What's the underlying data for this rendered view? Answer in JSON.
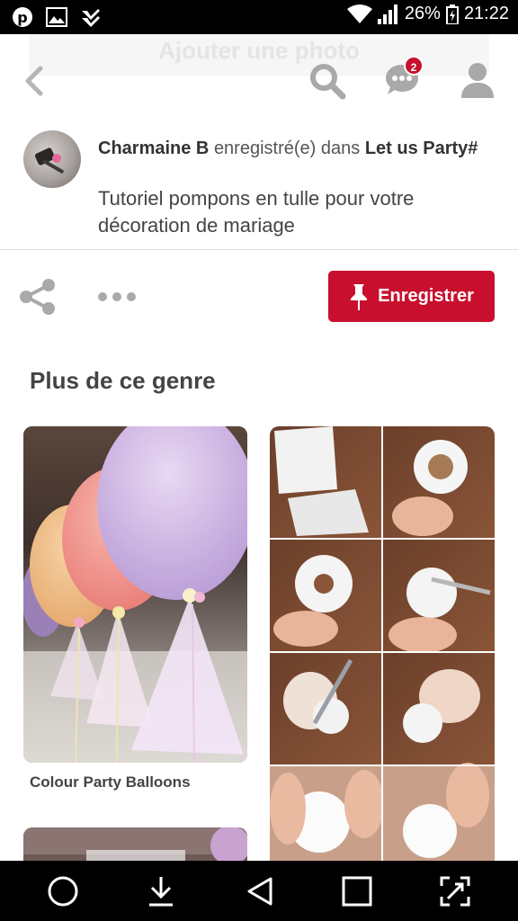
{
  "status_bar": {
    "battery": "26%",
    "time": "21:22"
  },
  "header": {
    "faded_banner": "Ajouter une photo",
    "message_badge": "2"
  },
  "pin": {
    "user_name": "Charmaine B",
    "saved_in_text": "enregistré(e) dans",
    "board_name": "Let us Party#",
    "description": "Tutoriel pompons en tulle pour votre décoration de mariage"
  },
  "actions": {
    "save_label": "Enregistrer"
  },
  "more_like_this": {
    "heading": "Plus de ce genre",
    "cards": [
      {
        "caption": "Colour Party Balloons"
      }
    ]
  },
  "colors": {
    "brand_red": "#c8102e",
    "icon_gray": "#a9a9a9"
  }
}
